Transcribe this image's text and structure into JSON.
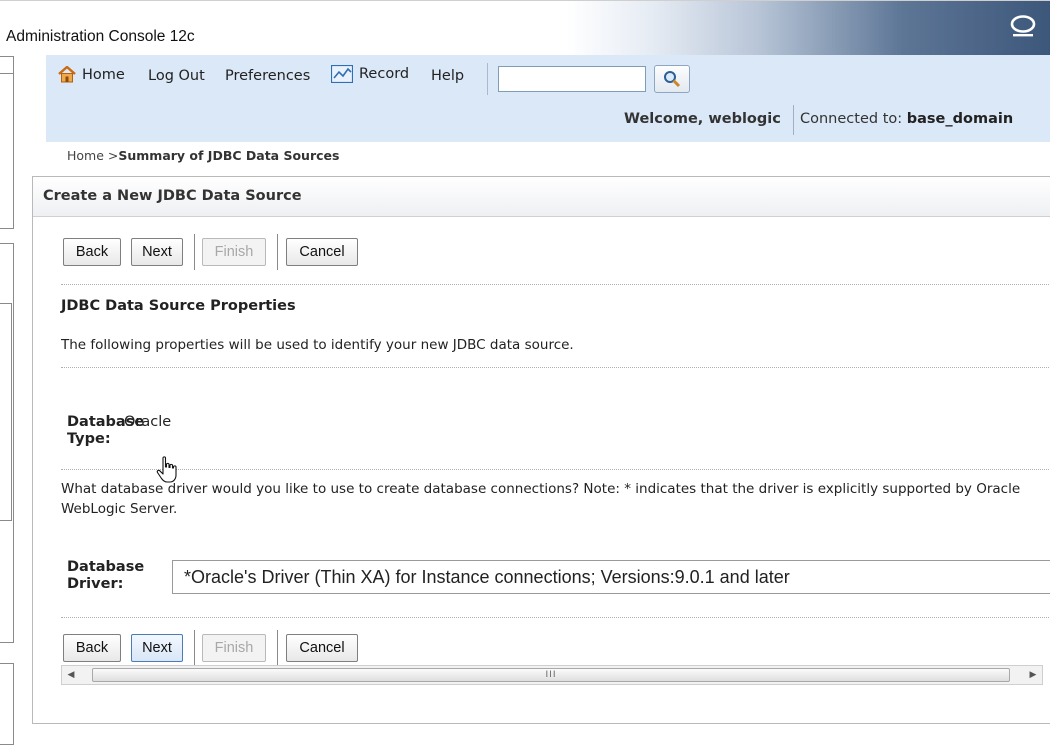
{
  "window": {
    "title": "Administration Console 12c",
    "logo_icon": "oracle-logo-icon"
  },
  "nav": {
    "home": "Home",
    "logout": "Log Out",
    "preferences": "Preferences",
    "record": "Record",
    "help": "Help",
    "search_value": "",
    "search_icon": "magnifier-icon",
    "welcome": "Welcome, weblogic",
    "connected_label": "Connected to:",
    "connected_domain": "base_domain"
  },
  "breadcrumb": {
    "home": "Home >",
    "current": "Summary of JDBC Data Sources"
  },
  "panel": {
    "title": "Create a New JDBC Data Source",
    "buttons": {
      "back": "Back",
      "next": "Next",
      "finish": "Finish",
      "cancel": "Cancel"
    },
    "section_heading": "JDBC Data Source Properties",
    "section_description": "The following properties will be used to identify your new JDBC data source.",
    "database_type_label_1": "Database",
    "database_type_label_2": "Type:",
    "database_type_value": "Oracle",
    "driver_question": "What database driver would you like to use to create database connections? Note: * indicates that the driver is explicitly supported by Oracle WebLogic Server.",
    "database_driver_label_1": "Database",
    "database_driver_label_2": "Driver:",
    "database_driver_value": "*Oracle's Driver (Thin XA) for Instance connections; Versions:9.0.1 and later",
    "scroll_thumb_grip": "III"
  },
  "colors": {
    "nav_band": "#dbe8f8",
    "title_gradient_end": "#3d577b",
    "panel_border": "#b9b9b9"
  }
}
